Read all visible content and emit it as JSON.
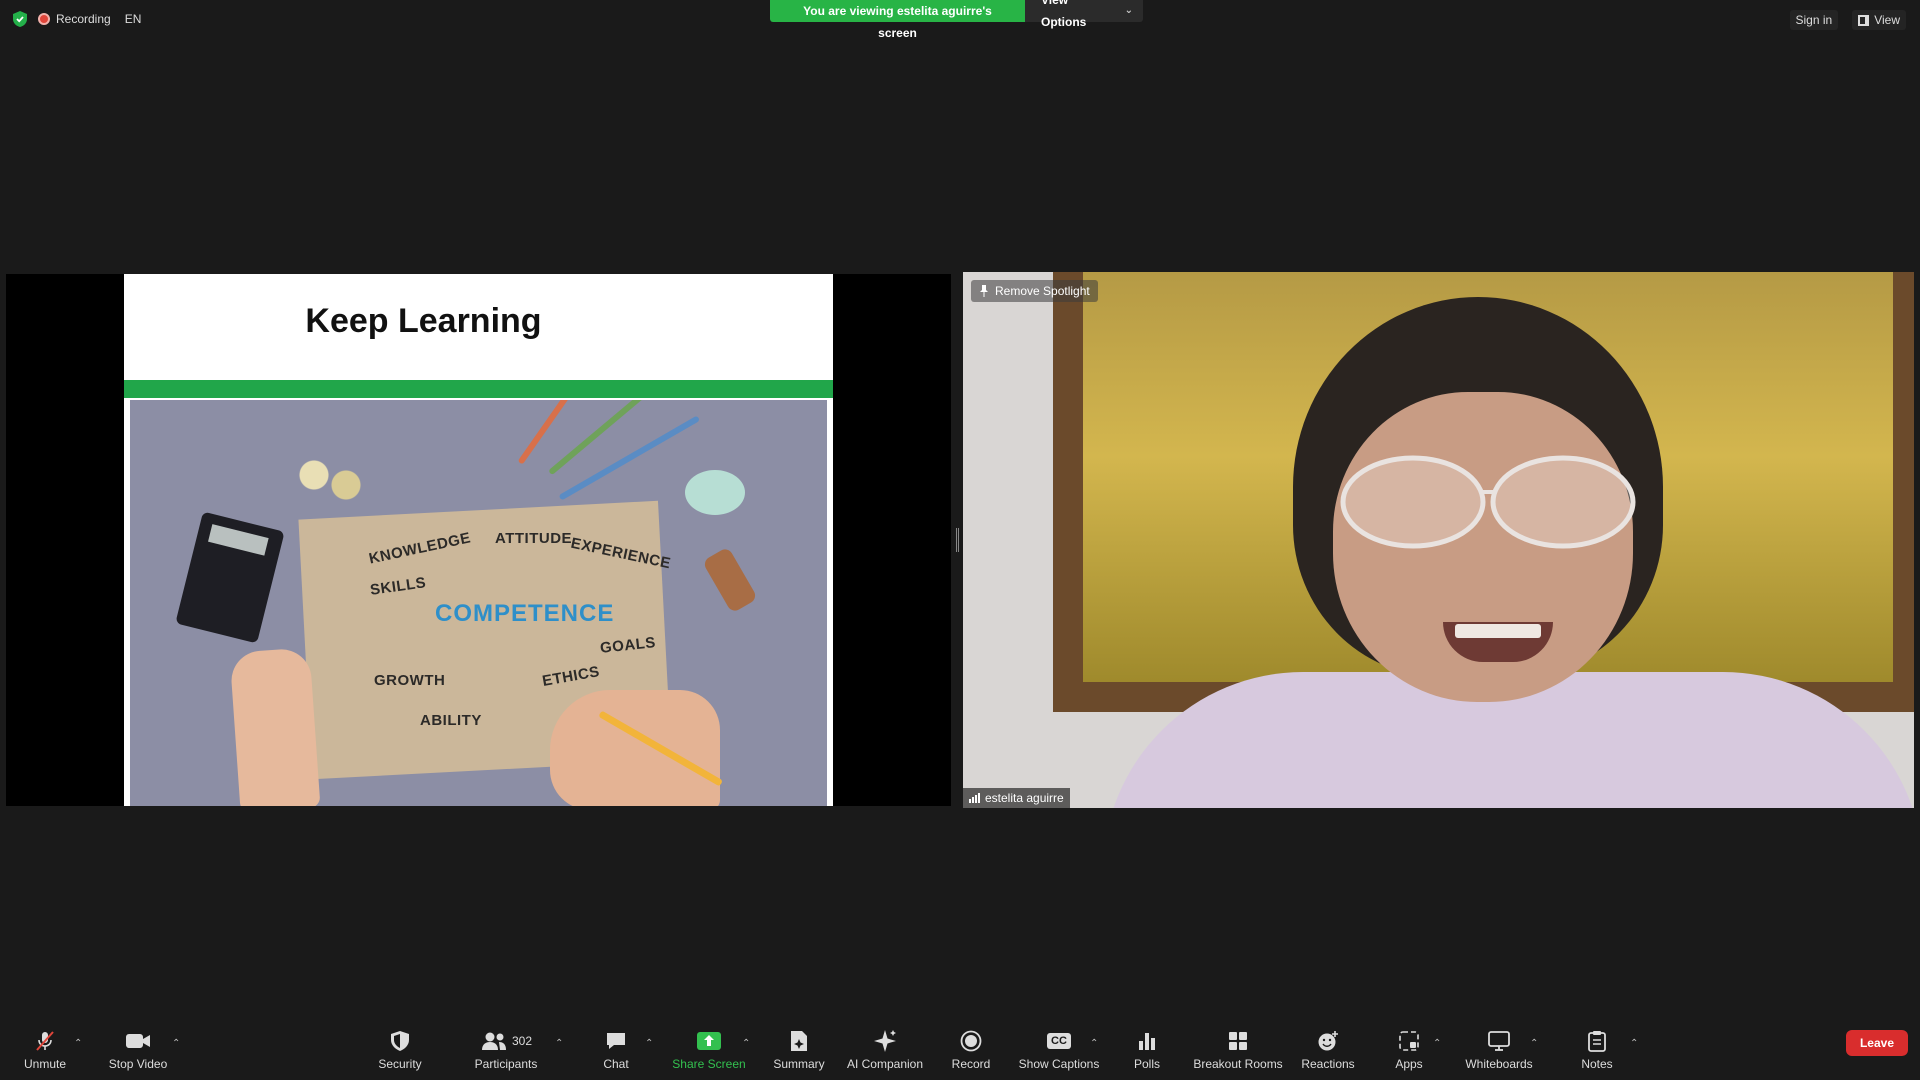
{
  "topbar": {
    "recording_label": "Recording",
    "language": "EN",
    "banner_text": "You are viewing estelita aguirre's screen",
    "view_options_label": "View Options",
    "sign_in_label": "Sign in",
    "view_label": "View"
  },
  "slide": {
    "title": "Keep Learning",
    "words": {
      "knowledge": "KNOWLEDGE",
      "attitude": "ATTITUDE",
      "experience": "EXPERIENCE",
      "skills": "SKILLS",
      "competence": "COMPETENCE",
      "goals": "GOALS",
      "growth": "GROWTH",
      "ethics": "ETHICS",
      "ability": "ABILITY"
    }
  },
  "video": {
    "remove_spotlight_label": "Remove Spotlight",
    "participant_name": "estelita aguirre"
  },
  "toolbar": {
    "unmute": "Unmute",
    "stop_video": "Stop Video",
    "security": "Security",
    "participants": "Participants",
    "participants_count": "302",
    "chat": "Chat",
    "share_screen": "Share Screen",
    "summary": "Summary",
    "ai_companion": "AI Companion",
    "record": "Record",
    "show_captions": "Show Captions",
    "polls": "Polls",
    "breakout_rooms": "Breakout Rooms",
    "reactions": "Reactions",
    "apps": "Apps",
    "whiteboards": "Whiteboards",
    "notes": "Notes",
    "leave": "Leave",
    "captions_icon_text": "CC"
  },
  "colors": {
    "accent_green": "#28b446",
    "leave_red": "#d92d2d",
    "background": "#1a1a1a"
  }
}
